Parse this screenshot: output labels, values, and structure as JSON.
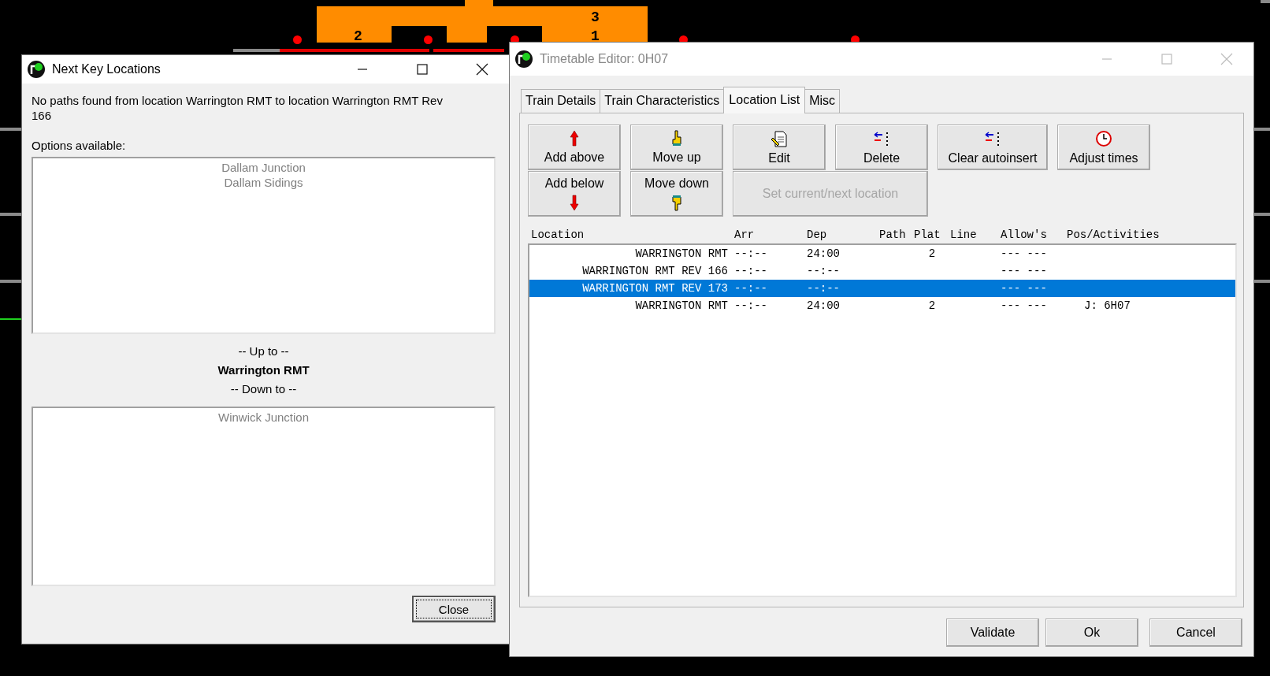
{
  "background": {
    "labels": [
      {
        "text": "3"
      },
      {
        "text": "2"
      },
      {
        "text": "1"
      }
    ]
  },
  "next_key_locations": {
    "title": "Next Key Locations",
    "message": "No paths found from location Warrington RMT to location Warrington RMT Rev 166",
    "options_label": "Options available:",
    "up_options": [
      "Dallam Junction",
      "Dallam Sidings"
    ],
    "up_to_label": "-- Up to --",
    "current_location": "Warrington RMT",
    "down_to_label": "-- Down to --",
    "down_options": [
      "Winwick Junction"
    ],
    "close_button": "Close"
  },
  "timetable_editor": {
    "title": "Timetable Editor: 0H07",
    "tabs": [
      {
        "label": "Train Details",
        "selected": false
      },
      {
        "label": "Train Characteristics",
        "selected": false
      },
      {
        "label": "Location List",
        "selected": true
      },
      {
        "label": "Misc",
        "selected": false
      }
    ],
    "buttons": [
      {
        "label": "Add above",
        "kind": "up",
        "disabled": false
      },
      {
        "label": "Add below",
        "kind": "down",
        "disabled": false
      },
      {
        "label": "Move up",
        "kind": "movup",
        "disabled": false
      },
      {
        "label": "Move down",
        "kind": "movdown",
        "disabled": false
      },
      {
        "label": "Edit",
        "kind": "edit",
        "disabled": false
      },
      {
        "label": "Delete",
        "kind": "delete",
        "disabled": false
      },
      {
        "label": "Set current/next location",
        "kind": "plain",
        "disabled": true
      },
      {
        "label": "Clear autoinsert",
        "kind": "delete",
        "disabled": false
      },
      {
        "label": "Adjust times",
        "kind": "clock",
        "disabled": false
      }
    ],
    "table": {
      "columns": [
        "Location",
        "Arr",
        "Dep",
        "Path",
        "Plat",
        "Line",
        "Allow's",
        "Pos/Activities"
      ],
      "rows": [
        {
          "location": "WARRINGTON RMT",
          "arr": "--:--",
          "dep": "24:00",
          "plat": "2",
          "allows": "--- ---",
          "selected": false
        },
        {
          "location": "WARRINGTON RMT REV 166",
          "arr": "--:--",
          "dep": "--:--",
          "allows": "--- ---",
          "selected": false
        },
        {
          "location": "WARRINGTON RMT REV 173",
          "arr": "--:--",
          "dep": "--:--",
          "allows": "--- ---",
          "selected": true
        },
        {
          "location": "WARRINGTON RMT",
          "arr": "--:--",
          "dep": "24:00",
          "plat": "2",
          "allows": "--- ---",
          "activities": "J: 6H07",
          "selected": false
        }
      ]
    },
    "footer_buttons": [
      "Validate",
      "Ok",
      "Cancel"
    ]
  }
}
